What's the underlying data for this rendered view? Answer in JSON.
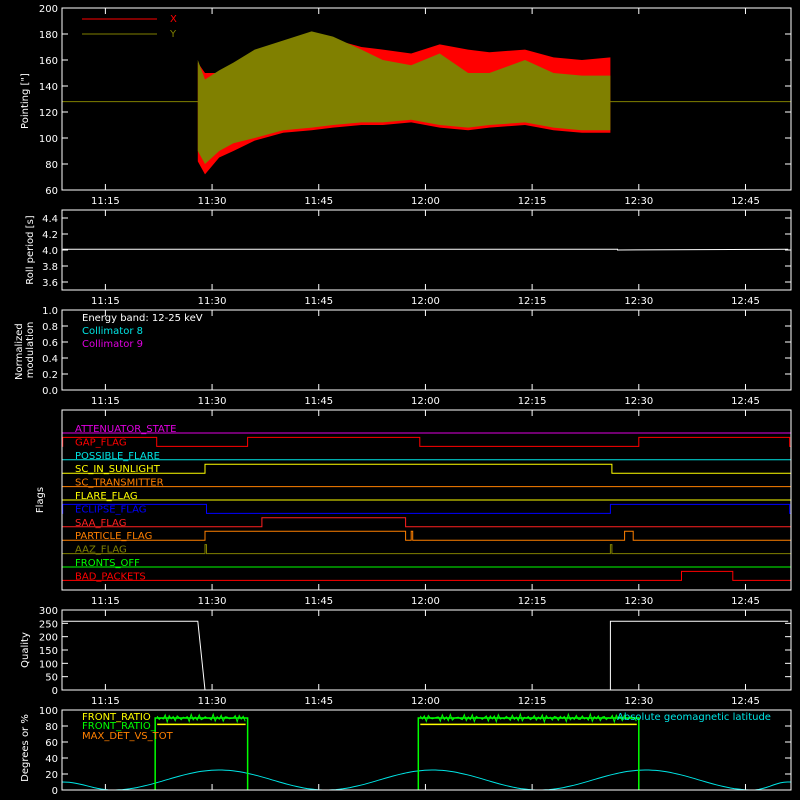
{
  "colors": {
    "background": "#000000",
    "axes": "#ffffff",
    "x_series": "#ff0000",
    "y_series": "#808000",
    "collimator8": "#00e5e5",
    "collimator9": "#e000e0",
    "front_ratio": "#ffff00",
    "front_ratio_2": "#00ff00",
    "max_det": "#ff8000",
    "geomag": "#00e5e5"
  },
  "time_ticks": [
    "11:15",
    "11:30",
    "11:45",
    "12:00",
    "12:15",
    "12:30",
    "12:45"
  ],
  "chart_data": [
    {
      "id": "pointing",
      "type": "area",
      "ylabel": "Pointing [\"]",
      "ylim": [
        60,
        200
      ],
      "yticks": [
        60,
        80,
        100,
        120,
        140,
        160,
        180,
        200
      ],
      "legend": [
        {
          "name": "X",
          "color": "#ff0000"
        },
        {
          "name": "Y",
          "color": "#808000"
        }
      ],
      "reference_level": 128,
      "x": [
        "11:28",
        "11:29",
        "11:31",
        "11:33",
        "11:36",
        "11:40",
        "11:44",
        "11:47",
        "11:51",
        "11:54",
        "11:58",
        "12:02",
        "12:06",
        "12:09",
        "12:14",
        "12:18",
        "12:22",
        "12:26"
      ],
      "series": [
        {
          "name": "X",
          "lower": [
            82,
            72,
            85,
            90,
            98,
            104,
            106,
            108,
            110,
            110,
            112,
            108,
            106,
            108,
            110,
            106,
            104,
            104
          ],
          "upper": [
            158,
            150,
            150,
            155,
            165,
            172,
            178,
            176,
            170,
            168,
            165,
            172,
            168,
            166,
            168,
            162,
            160,
            162
          ]
        },
        {
          "name": "Y",
          "lower": [
            90,
            80,
            90,
            96,
            100,
            106,
            108,
            110,
            112,
            112,
            114,
            110,
            108,
            110,
            112,
            108,
            106,
            106
          ],
          "upper": [
            160,
            145,
            152,
            158,
            168,
            175,
            182,
            178,
            168,
            160,
            156,
            165,
            150,
            150,
            160,
            150,
            148,
            148
          ]
        }
      ]
    },
    {
      "id": "roll",
      "type": "line",
      "ylabel": "Roll period [s]",
      "ylim": [
        3.5,
        4.5
      ],
      "yticks": [
        "3.6",
        "3.8",
        "4.0",
        "4.2",
        "4.4"
      ],
      "x": [
        "11:09",
        "12:27",
        "12:27",
        "12:51"
      ],
      "values": [
        4.01,
        4.01,
        4.0,
        4.01
      ]
    },
    {
      "id": "modulation",
      "type": "line",
      "ylabel": "Normalized modulation",
      "ylim": [
        0,
        1
      ],
      "yticks": [
        "0.0",
        "0.2",
        "0.4",
        "0.6",
        "0.8",
        "1.0"
      ],
      "annotations": [
        "Energy band: 12-25 keV",
        "Collimator 8",
        "Collimator 9"
      ],
      "series": [
        {
          "name": "Collimator 8",
          "x": [
            "11:09",
            "12:51"
          ],
          "values": [
            0.0,
            0.0
          ]
        },
        {
          "name": "Collimator 9",
          "x": [
            "11:09",
            "12:51"
          ],
          "values": [
            0.0,
            0.0
          ]
        }
      ]
    },
    {
      "id": "flags",
      "type": "line",
      "ylabel": "Flags",
      "flags": [
        {
          "name": "ATTENUATOR_STATE",
          "color": "#e000e0",
          "on": []
        },
        {
          "name": "GAP_FLAG",
          "color": "#ff0000",
          "on": [
            [
              "11:09",
              "11:22"
            ],
            [
              "11:35",
              "11:59"
            ],
            [
              "12:30",
              "12:51"
            ]
          ]
        },
        {
          "name": "POSSIBLE_FLARE",
          "color": "#00e5e5",
          "on": []
        },
        {
          "name": "SC_IN_SUNLIGHT",
          "color": "#ffff00",
          "on": [
            [
              "11:29",
              "12:26"
            ]
          ]
        },
        {
          "name": "SC_TRANSMITTER",
          "color": "#ff8000",
          "on": []
        },
        {
          "name": "FLARE_FLAG",
          "color": "#ffff00",
          "on": []
        },
        {
          "name": "ECLIPSE_FLAG",
          "color": "#0000ff",
          "on": [
            [
              "11:09",
              "11:29"
            ],
            [
              "12:26",
              "12:51"
            ]
          ]
        },
        {
          "name": "SAA_FLAG",
          "color": "#ff2020",
          "on": [
            [
              "11:37",
              "11:57"
            ]
          ]
        },
        {
          "name": "PARTICLE_FLAG",
          "color": "#ff8000",
          "on": [
            [
              "11:29",
              "11:57"
            ],
            [
              "11:58",
              "11:58"
            ],
            [
              "12:28",
              "12:29"
            ]
          ]
        },
        {
          "name": "AAZ_FLAG",
          "color": "#808000",
          "on": [
            [
              "11:29",
              "11:29"
            ],
            [
              "12:26",
              "12:26"
            ]
          ]
        },
        {
          "name": "FRONTS_OFF",
          "color": "#00ff00",
          "on": []
        },
        {
          "name": "BAD_PACKETS",
          "color": "#ff0000",
          "on": [
            [
              "12:36",
              "12:43"
            ]
          ]
        }
      ]
    },
    {
      "id": "quality",
      "type": "line",
      "ylabel": "Quality",
      "ylim": [
        0,
        300
      ],
      "yticks": [
        "0",
        "50",
        "100",
        "150",
        "200",
        "250",
        "300"
      ],
      "x": [
        "11:09",
        "11:28",
        "11:29",
        "12:26",
        "12:26",
        "12:51"
      ],
      "values": [
        258,
        258,
        0,
        0,
        258,
        258
      ]
    },
    {
      "id": "ratios",
      "type": "line",
      "ylabel": "Degrees or %",
      "ylim": [
        0,
        100
      ],
      "yticks": [
        "0",
        "20",
        "40",
        "60",
        "80",
        "100"
      ],
      "legend": [
        {
          "name": "FRONT_RATIO",
          "color": "#ffff00"
        },
        {
          "name": "FRONT_RATIO_",
          "color": "#00ff00"
        },
        {
          "name": "MAX_DET_VS_TOT",
          "color": "#ff8000"
        },
        {
          "name": "Absolute geomagnetic latitude",
          "color": "#00e5e5"
        }
      ],
      "intervals": [
        [
          "11:22",
          "11:35"
        ],
        [
          "11:59",
          "12:30"
        ]
      ],
      "front_ratio_level": 82,
      "front_ratio_2_level": 90,
      "max_det_level": 0,
      "geomag": {
        "x": [
          "11:09",
          "11:16",
          "11:31",
          "11:46",
          "12:01",
          "12:16",
          "12:31",
          "12:46",
          "12:51"
        ],
        "values": [
          10,
          0,
          25,
          0,
          25,
          0,
          25,
          0,
          10
        ]
      }
    }
  ]
}
